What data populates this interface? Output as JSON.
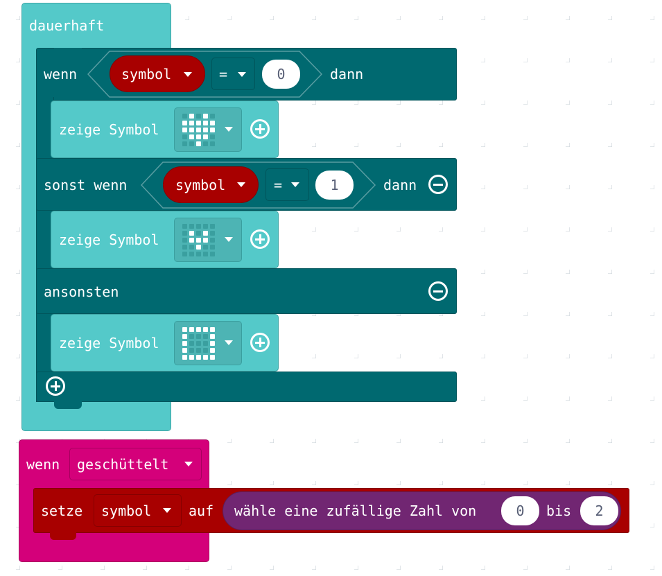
{
  "forever_block": {
    "label": "dauerhaft"
  },
  "if_block": {
    "if_label": "wenn",
    "then_label": "dann",
    "elseif_label": "sonst wenn",
    "else_label": "ansonsten",
    "condition1": {
      "variable": "symbol",
      "operator": "=",
      "value": "0"
    },
    "condition2": {
      "variable": "symbol",
      "operator": "=",
      "value": "1"
    }
  },
  "show_icon_blocks": [
    {
      "label": "zeige Symbol",
      "icon": "heart-icon",
      "leds": [
        0,
        1,
        0,
        1,
        0,
        1,
        1,
        1,
        1,
        1,
        1,
        1,
        1,
        1,
        1,
        0,
        1,
        1,
        1,
        0,
        0,
        0,
        1,
        0,
        0
      ]
    },
    {
      "label": "zeige Symbol",
      "icon": "small-heart-icon",
      "leds": [
        0,
        0,
        0,
        0,
        0,
        0,
        1,
        0,
        1,
        0,
        0,
        1,
        1,
        1,
        0,
        0,
        0,
        1,
        0,
        0,
        0,
        0,
        0,
        0,
        0
      ]
    },
    {
      "label": "zeige Symbol",
      "icon": "square-icon",
      "leds": [
        1,
        1,
        1,
        1,
        1,
        1,
        0,
        0,
        0,
        1,
        1,
        0,
        0,
        0,
        1,
        1,
        0,
        0,
        0,
        1,
        1,
        1,
        1,
        1,
        1
      ]
    }
  ],
  "on_gesture_block": {
    "label": "wenn",
    "gesture": "geschüttelt"
  },
  "set_block": {
    "set_label": "setze",
    "variable": "symbol",
    "to_label": "auf",
    "random": {
      "label": "wähle eine zufällige Zahl von",
      "from": "0",
      "to_label": "bis",
      "to": "2"
    }
  },
  "colors": {
    "basic": "#54C9C9",
    "logic": "#006970",
    "input": "#D4007A",
    "variables": "#A80000",
    "math": "#712672",
    "led_on": "#ffffff",
    "led_off": "#3A9F9F"
  }
}
